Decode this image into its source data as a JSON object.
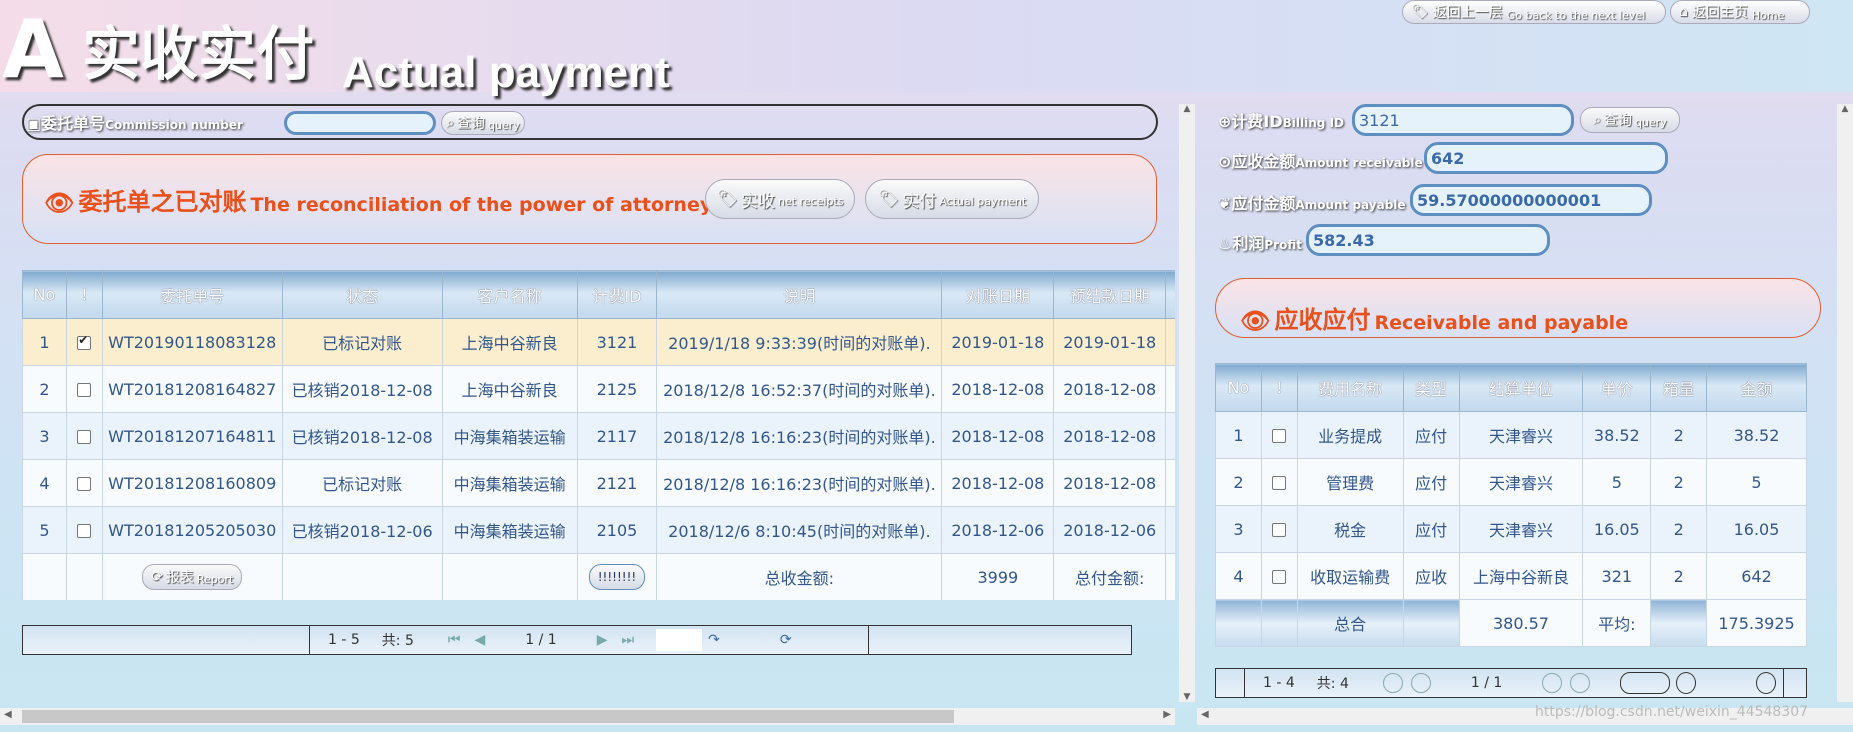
{
  "header": {
    "logo_letter": "A",
    "title_cn": "实收实付",
    "title_en": "Actual payment",
    "back_cn": "返回上一层",
    "back_en": "Go back to the next level",
    "home_cn": "返回主页",
    "home_en": "Home"
  },
  "left": {
    "commission_label_cn": "委托单号",
    "commission_label_en": "Commission number",
    "commission_value": "",
    "query_cn": "查询",
    "query_en": "query",
    "section_title_cn": "委托单之已对账",
    "section_title_en": "The reconciliation of the power of attorney",
    "net_receipts_cn": "实收",
    "net_receipts_en": "net receipts",
    "actual_payment_cn": "实付",
    "actual_payment_en": "Actual payment",
    "columns": [
      "No",
      "!",
      "委托单号",
      "状态",
      "客户名称",
      "计费ID",
      "说明",
      "对账日期",
      "预结款日期"
    ],
    "rows": [
      {
        "no": "1",
        "checked": true,
        "order": "WT20190118083128",
        "status": "已标记对账",
        "customer": "上海中谷新良",
        "billing_id": "3121",
        "desc": "2019/1/18 9:33:39(时间的对账单).",
        "recon_date": "2019-01-18",
        "pay_date": "2019-01-18"
      },
      {
        "no": "2",
        "checked": false,
        "order": "WT20181208164827",
        "status": "已核销2018-12-08",
        "customer": "上海中谷新良",
        "billing_id": "2125",
        "desc": "2018/12/8 16:52:37(时间的对账单).",
        "recon_date": "2018-12-08",
        "pay_date": "2018-12-08"
      },
      {
        "no": "3",
        "checked": false,
        "order": "WT20181207164811",
        "status": "已核销2018-12-08",
        "customer": "中海集箱装运输",
        "billing_id": "2117",
        "desc": "2018/12/8 16:16:23(时间的对账单).",
        "recon_date": "2018-12-08",
        "pay_date": "2018-12-08"
      },
      {
        "no": "4",
        "checked": false,
        "order": "WT20181208160809",
        "status": "已标记对账",
        "customer": "中海集箱装运输",
        "billing_id": "2121",
        "desc": "2018/12/8 16:16:23(时间的对账单).",
        "recon_date": "2018-12-08",
        "pay_date": "2018-12-08"
      },
      {
        "no": "5",
        "checked": false,
        "order": "WT20181205205030",
        "status": "已核销2018-12-06",
        "customer": "中海集箱装运输",
        "billing_id": "2105",
        "desc": "2018/12/6 8:10:45(时间的对账单).",
        "recon_date": "2018-12-06",
        "pay_date": "2018-12-06"
      }
    ],
    "footer": {
      "report_cn": "报表",
      "report_en": "Report",
      "mini_btn": "!!!!!!!!",
      "total_received_label": "总收金额:",
      "total_received": "3999",
      "total_paid_label": "总付金额:"
    },
    "pager": {
      "range": "1 - 5",
      "total": "共: 5",
      "page": "1 / 1"
    }
  },
  "right": {
    "billing_label_cn": "计费ID",
    "billing_label_en": "Billing ID",
    "billing_value": "3121",
    "query_cn": "查询",
    "query_en": "query",
    "receivable_label_cn": "应收金额",
    "receivable_label_en": "Amount receivable",
    "receivable_value": "642",
    "payable_label_cn": "应付金额",
    "payable_label_en": "Amount payable",
    "payable_value": "59.57000000000001",
    "profit_label_cn": "利润",
    "profit_label_en": "Profit",
    "profit_value": "582.43",
    "section_title_cn": "应收应付",
    "section_title_en": "Receivable and payable",
    "columns": [
      "No",
      "!",
      "费用名称",
      "类型",
      "结算单位",
      "单价",
      "箱量",
      "金额"
    ],
    "rows": [
      {
        "no": "1",
        "fee": "业务提成",
        "type": "应付",
        "unit": "天津睿兴",
        "price": "38.52",
        "qty": "2",
        "amount": "38.52"
      },
      {
        "no": "2",
        "fee": "管理费",
        "type": "应付",
        "unit": "天津睿兴",
        "price": "5",
        "qty": "2",
        "amount": "5"
      },
      {
        "no": "3",
        "fee": "税金",
        "type": "应付",
        "unit": "天津睿兴",
        "price": "16.05",
        "qty": "2",
        "amount": "16.05"
      },
      {
        "no": "4",
        "fee": "收取运输费",
        "type": "应收",
        "unit": "上海中谷新良",
        "price": "321",
        "qty": "2",
        "amount": "642"
      }
    ],
    "footer": {
      "total_label": "总合",
      "total": "380.57",
      "avg_label": "平均:",
      "avg": "175.3925"
    },
    "pager": {
      "range": "1 - 4",
      "total": "共: 4",
      "page": "1 / 1"
    }
  },
  "watermark": "https://blog.csdn.net/weixin_44548307"
}
